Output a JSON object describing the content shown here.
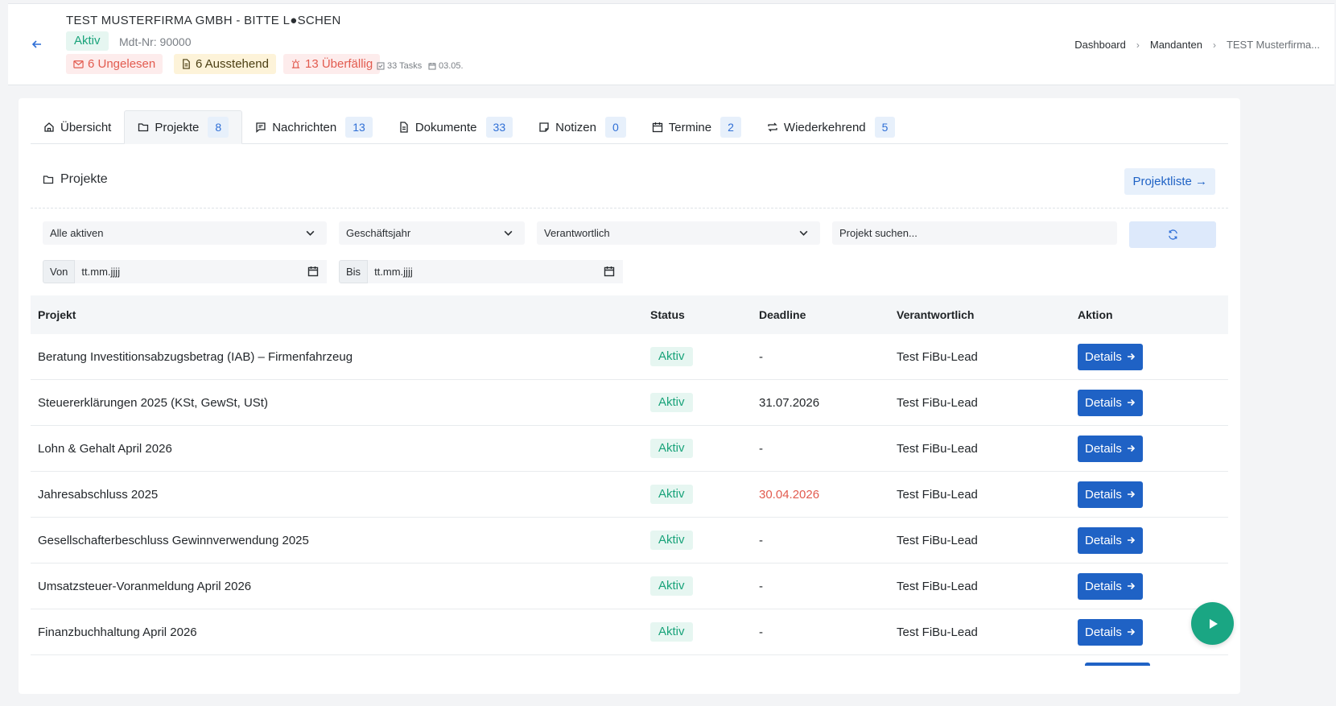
{
  "header": {
    "company": "TEST MUSTERFIRMA GMBH - BITTE L●SCHEN",
    "status": "Aktiv",
    "mandant_nr": "Mdt-Nr: 90000",
    "badges": {
      "unread": "6 Ungelesen",
      "pending": "6 Ausstehend",
      "overdue": "13 Überfällig"
    },
    "tasks": "33 Tasks",
    "date": "03.05."
  },
  "breadcrumb": [
    "Dashboard",
    "Mandanten",
    "TEST Musterfirma..."
  ],
  "tabs": [
    {
      "label": "Übersicht",
      "count": ""
    },
    {
      "label": "Projekte",
      "count": "8"
    },
    {
      "label": "Nachrichten",
      "count": "13"
    },
    {
      "label": "Dokumente",
      "count": "33"
    },
    {
      "label": "Notizen",
      "count": "0"
    },
    {
      "label": "Termine",
      "count": "2"
    },
    {
      "label": "Wiederkehrend",
      "count": "5"
    }
  ],
  "section": {
    "title": "Projekte",
    "list_button": "Projektliste →"
  },
  "filters": {
    "status": "Alle aktiven",
    "fiscal_year": "Geschäftsjahr",
    "responsible": "Verantwortlich",
    "search_placeholder": "Projekt suchen...",
    "from_label": "Von",
    "from_value": "tt.mm.jjjj",
    "to_label": "Bis",
    "to_value": "tt.mm.jjjj"
  },
  "table": {
    "headers": [
      "Projekt",
      "Status",
      "Deadline",
      "Verantwortlich",
      "Aktion"
    ],
    "rows": [
      {
        "project": "Beratung Investitionsabzugsbetrag (IAB) – Firmenfahrzeug",
        "status": "Aktiv",
        "deadline": "-",
        "responsible": "Test FiBu-Lead",
        "action": "Details"
      },
      {
        "project": "Steuererklärungen 2025 (KSt, GewSt, USt)",
        "status": "Aktiv",
        "deadline": "31.07.2026",
        "responsible": "Test FiBu-Lead",
        "action": "Details"
      },
      {
        "project": "Lohn & Gehalt April 2026",
        "status": "Aktiv",
        "deadline": "-",
        "responsible": "Test FiBu-Lead",
        "action": "Details"
      },
      {
        "project": "Jahresabschluss 2025",
        "status": "Aktiv",
        "deadline": "30.04.2026",
        "responsible": "Test FiBu-Lead",
        "action": "Details"
      },
      {
        "project": "Gesellschafterbeschluss Gewinnverwendung 2025",
        "status": "Aktiv",
        "deadline": "-",
        "responsible": "Test FiBu-Lead",
        "action": "Details"
      },
      {
        "project": "Umsatzsteuer-Voranmeldung April 2026",
        "status": "Aktiv",
        "deadline": "-",
        "responsible": "Test FiBu-Lead",
        "action": "Details"
      },
      {
        "project": "Finanzbuchhaltung April 2026",
        "status": "Aktiv",
        "deadline": "-",
        "responsible": "Test FiBu-Lead",
        "action": "Details"
      }
    ]
  },
  "colors": {
    "primary": "#1f62c5",
    "success": "#19a37a",
    "danger": "#e25b4f",
    "fab": "#1aa683"
  }
}
